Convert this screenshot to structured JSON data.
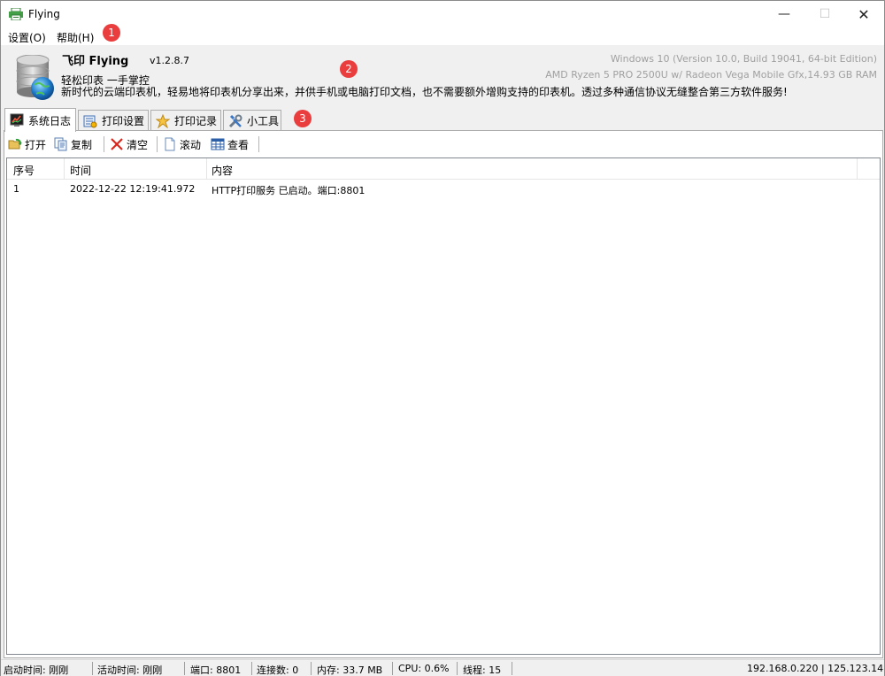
{
  "window": {
    "title": "Flying"
  },
  "menu": {
    "settings": "设置(O)",
    "help": "帮助(H)"
  },
  "markers": [
    "1",
    "2",
    "3"
  ],
  "header": {
    "brand": "飞印 Flying",
    "version": "v1.2.8.7",
    "slogan": "轻松印表 一手掌控",
    "description": "新时代的云端印表机，轻易地将印表机分享出来，并供手机或电脑打印文档，也不需要额外增购支持的印表机。透过多种通信协议无缝整合第三方软件服务!",
    "os_info": "Windows 10 (Version 10.0, Build 19041, 64-bit Edition)",
    "hw_info": "AMD Ryzen 5 PRO 2500U w/ Radeon Vega Mobile Gfx,14.93 GB RAM"
  },
  "tabs": [
    {
      "label": "系统日志",
      "icon": "log-monitor-icon"
    },
    {
      "label": "打印设置",
      "icon": "print-settings-icon"
    },
    {
      "label": "打印记录",
      "icon": "print-history-icon"
    },
    {
      "label": "小工具",
      "icon": "tools-icon"
    }
  ],
  "toolbar": {
    "open": "打开",
    "copy": "复制",
    "clear": "清空",
    "scroll": "滚动",
    "view": "查看"
  },
  "table": {
    "columns": [
      "序号",
      "时间",
      "内容"
    ],
    "rows": [
      {
        "index": "1",
        "time": "2022-12-22 12:19:41.972",
        "content": "HTTP打印服务 已启动。端口:8801"
      }
    ]
  },
  "status": {
    "start_time": "启动时间: 刚刚",
    "active_time": "活动时间: 刚刚",
    "port": "端口: 8801",
    "connections": "连接数: 0",
    "memory": "内存: 33.7 MB",
    "cpu": "CPU: 0.6%",
    "threads": "线程: 15",
    "ip": "192.168.0.220 | 125.123.14"
  },
  "colors": {
    "marker": "#ea3d3d",
    "sysinfo_text": "#a0a0a0",
    "panel_border": "#adadad"
  }
}
